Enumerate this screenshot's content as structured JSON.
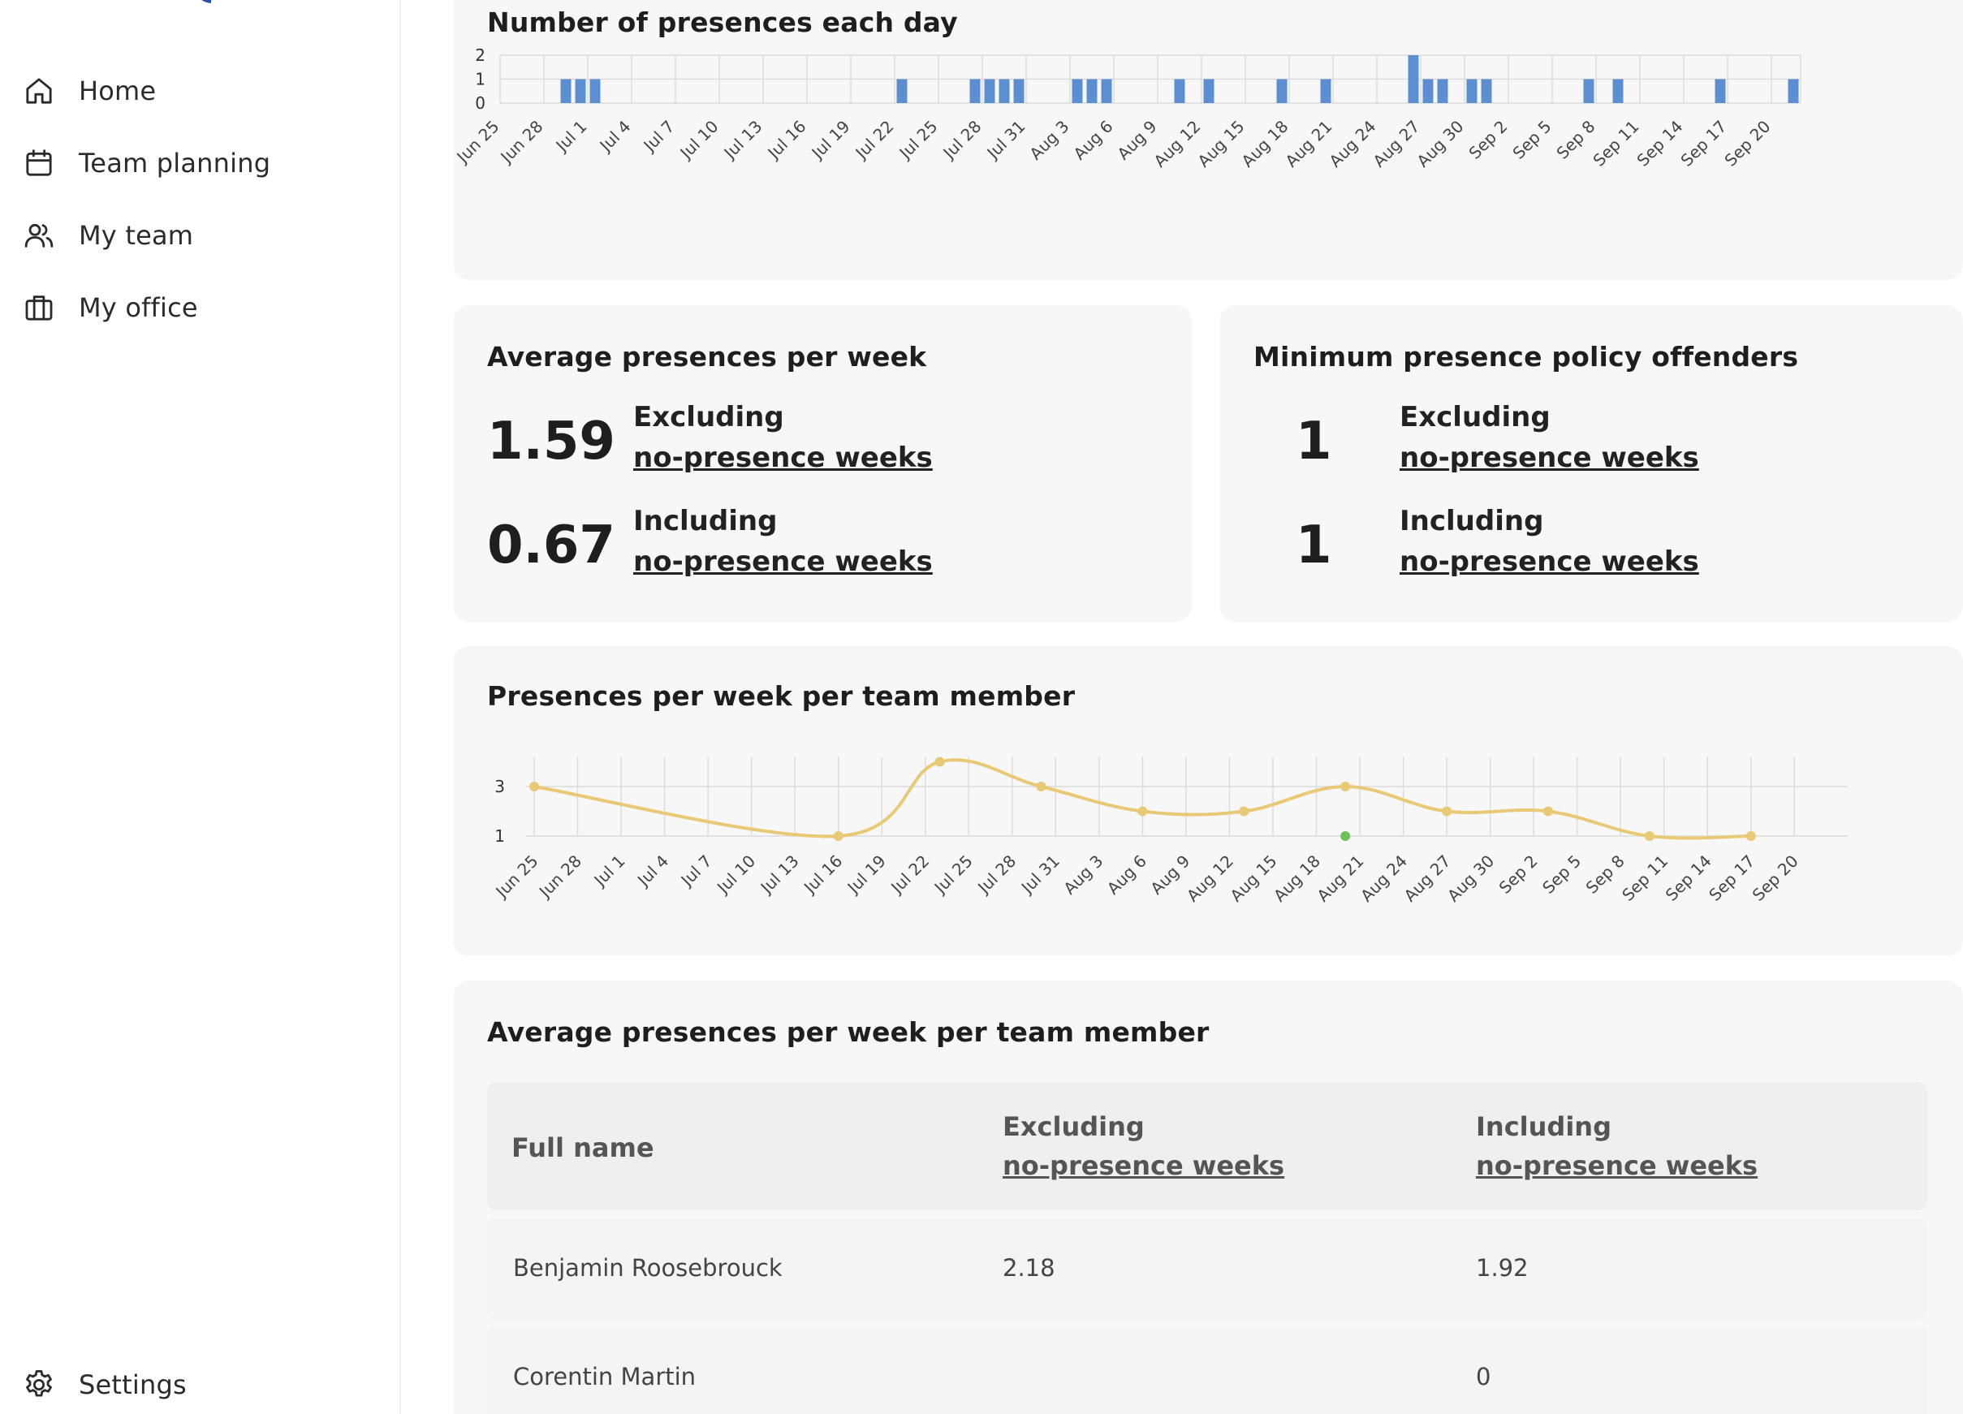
{
  "sidebar": {
    "items": [
      {
        "label": "Home",
        "icon": "home-icon"
      },
      {
        "label": "Team planning",
        "icon": "calendar-icon"
      },
      {
        "label": "My team",
        "icon": "team-icon"
      },
      {
        "label": "My office",
        "icon": "office-icon"
      }
    ],
    "settings": {
      "label": "Settings",
      "icon": "gear-icon"
    }
  },
  "cards": {
    "daily_title": "Number of presences each day",
    "avg": {
      "title": "Average presences per week",
      "excluding_value": "1.59",
      "including_value": "0.67",
      "excluding_label": "Excluding",
      "including_label": "Including",
      "link": "no-presence weeks"
    },
    "offenders": {
      "title": "Minimum presence policy offenders",
      "excluding_value": "1",
      "including_value": "1",
      "excluding_label": "Excluding",
      "including_label": "Including",
      "link": "no-presence weeks"
    },
    "weekly_title": "Presences per week per team member",
    "table": {
      "title": "Average presences per week per team member",
      "headers": {
        "name": "Full name",
        "excluding": "Excluding",
        "including": "Including",
        "link": "no-presence weeks"
      },
      "rows": [
        {
          "name": "Benjamin Roosebrouck",
          "excluding": "2.18",
          "including": "1.92"
        },
        {
          "name": "Corentin Martin",
          "excluding": "",
          "including": "0"
        }
      ]
    }
  },
  "colors": {
    "bar": "#5b8fd2",
    "line": "#e8c976",
    "green_point": "#6cc25a",
    "card_bg": "#f7f7f7"
  },
  "chart_data": [
    {
      "type": "bar",
      "ylim": [
        0,
        2
      ],
      "yticks": [
        0,
        1,
        2
      ],
      "xtick_labels": [
        "Jun 25",
        "Jun 28",
        "Jul 1",
        "Jul 4",
        "Jul 7",
        "Jul 10",
        "Jul 13",
        "Jul 16",
        "Jul 19",
        "Jul 22",
        "Jul 25",
        "Jul 28",
        "Jul 31",
        "Aug 3",
        "Aug 6",
        "Aug 9",
        "Aug 12",
        "Aug 15",
        "Aug 18",
        "Aug 21",
        "Aug 24",
        "Aug 27",
        "Aug 30",
        "Sep 2",
        "Sep 5",
        "Sep 8",
        "Sep 11",
        "Sep 14",
        "Sep 17",
        "Sep 20"
      ],
      "x": [
        "Jun 29",
        "Jun 30",
        "Jul 1",
        "Jul 22",
        "Jul 27",
        "Jul 28",
        "Jul 29",
        "Jul 30",
        "Aug 3",
        "Aug 4",
        "Aug 5",
        "Aug 10",
        "Aug 12",
        "Aug 17",
        "Aug 20",
        "Aug 26",
        "Aug 27",
        "Aug 28",
        "Aug 30",
        "Aug 31",
        "Sep 7",
        "Sep 9",
        "Sep 16",
        "Sep 21"
      ],
      "values": [
        1,
        1,
        1,
        1,
        1,
        1,
        1,
        1,
        1,
        1,
        1,
        1,
        1,
        1,
        1,
        2,
        1,
        1,
        1,
        1,
        1,
        1,
        1,
        1
      ],
      "grid": true
    },
    {
      "type": "line",
      "yticks": [
        1,
        3
      ],
      "xtick_labels": [
        "Jun 25",
        "Jun 28",
        "Jul 1",
        "Jul 4",
        "Jul 7",
        "Jul 10",
        "Jul 13",
        "Jul 16",
        "Jul 19",
        "Jul 22",
        "Jul 25",
        "Jul 28",
        "Jul 31",
        "Aug 3",
        "Aug 6",
        "Aug 9",
        "Aug 12",
        "Aug 15",
        "Aug 18",
        "Aug 21",
        "Aug 24",
        "Aug 27",
        "Aug 30",
        "Sep 2",
        "Sep 5",
        "Sep 8",
        "Sep 11",
        "Sep 14",
        "Sep 17",
        "Sep 20"
      ],
      "series": [
        {
          "x": [
            "Jun 25",
            "Jul 16",
            "Jul 23",
            "Jul 30",
            "Aug 6",
            "Aug 13",
            "Aug 20",
            "Aug 27",
            "Sep 3",
            "Sep 10",
            "Sep 17"
          ],
          "values": [
            3,
            1,
            4,
            3,
            2,
            2,
            3,
            2,
            2,
            1,
            1
          ],
          "color": "#e8c976"
        },
        {
          "x": [
            "Aug 20"
          ],
          "values": [
            1
          ],
          "color": "#6cc25a"
        }
      ],
      "grid": true
    }
  ]
}
